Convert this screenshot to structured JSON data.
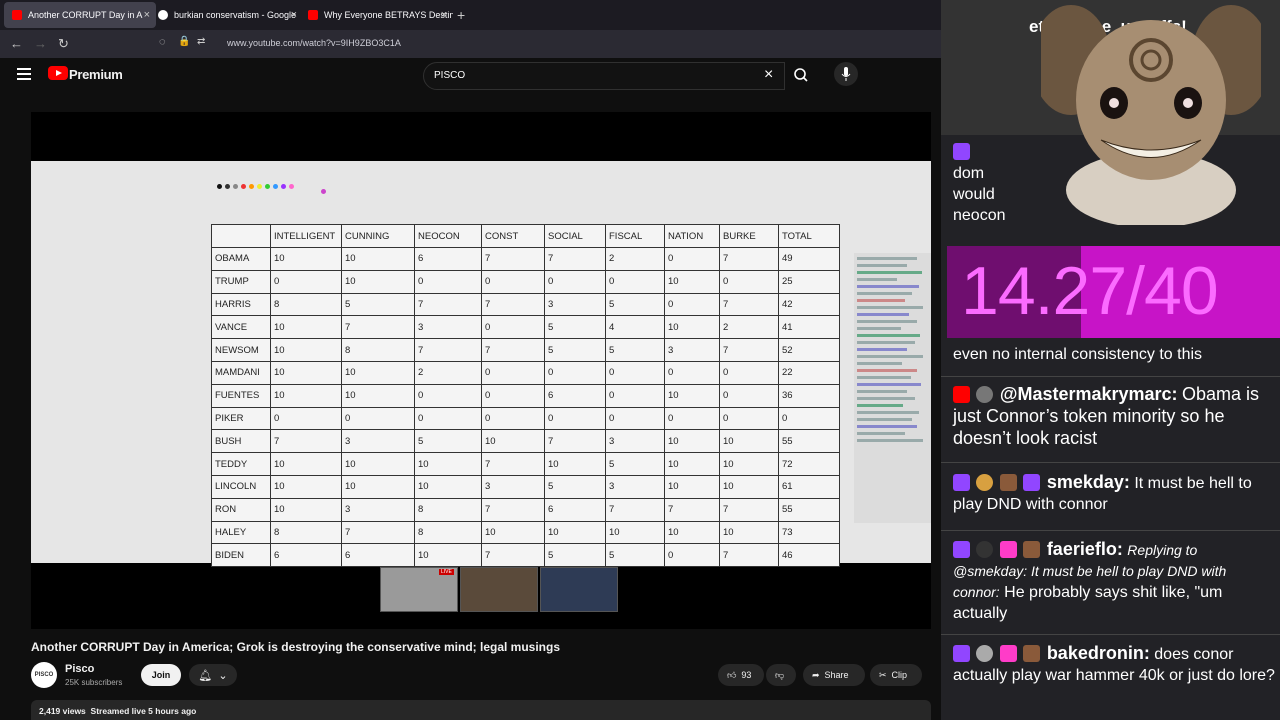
{
  "browser": {
    "tabs": [
      {
        "title": "Another CORRUPT Day in A",
        "active": true
      },
      {
        "title": "burkian conservatism - Google",
        "active": false
      },
      {
        "title": "Why Everyone BETRAYS Destiny",
        "active": false
      }
    ],
    "url": "www.youtube.com/watch?v=9IH9ZBO3C1A"
  },
  "youtube": {
    "logo_text": "Premium",
    "search_value": "PISCO",
    "video_title": "Another CORRUPT Day in America; Grok is destroying the conservative mind; legal musings",
    "channel": {
      "name": "Pisco",
      "subscribers": "25K subscribers",
      "avatar_text": "PISCO"
    },
    "join_label": "Join",
    "likes": "93",
    "share_label": "Share",
    "clip_label": "Clip",
    "views": "2,419 views",
    "streamed": "Streamed live 5 hours ago",
    "live_badge": "LIVE"
  },
  "table": {
    "headers": [
      "",
      "INTELLIGENT",
      "CUNNING",
      "NEOCON",
      "CONST",
      "SOCIAL",
      "FISCAL",
      "NATION",
      "BURKE",
      "TOTAL"
    ],
    "rows": [
      [
        "OBAMA",
        "10",
        "10",
        "6",
        "7",
        "7",
        "2",
        "0",
        "7",
        "49"
      ],
      [
        "TRUMP",
        "0",
        "10",
        "0",
        "0",
        "0",
        "0",
        "10",
        "0",
        "25"
      ],
      [
        "HARRIS",
        "8",
        "5",
        "7",
        "7",
        "3",
        "5",
        "0",
        "7",
        "42"
      ],
      [
        "VANCE",
        "10",
        "7",
        "3",
        "0",
        "5",
        "4",
        "10",
        "2",
        "41"
      ],
      [
        "NEWSOM",
        "10",
        "8",
        "7",
        "7",
        "5",
        "5",
        "3",
        "7",
        "52"
      ],
      [
        "MAMDANI",
        "10",
        "10",
        "2",
        "0",
        "0",
        "0",
        "0",
        "0",
        "22"
      ],
      [
        "FUENTES",
        "10",
        "10",
        "0",
        "0",
        "6",
        "0",
        "10",
        "0",
        "36"
      ],
      [
        "PIKER",
        "0",
        "0",
        "0",
        "0",
        "0",
        "0",
        "0",
        "0",
        "0"
      ],
      [
        "BUSH",
        "7",
        "3",
        "5",
        "10",
        "7",
        "3",
        "10",
        "10",
        "55"
      ],
      [
        "TEDDY",
        "10",
        "10",
        "10",
        "7",
        "10",
        "5",
        "10",
        "10",
        "72"
      ],
      [
        "LINCOLN",
        "10",
        "10",
        "10",
        "3",
        "5",
        "3",
        "10",
        "10",
        "61"
      ],
      [
        "RON",
        "10",
        "3",
        "8",
        "7",
        "6",
        "7",
        "7",
        "7",
        "55"
      ],
      [
        "HALEY",
        "8",
        "7",
        "8",
        "10",
        "10",
        "10",
        "10",
        "10",
        "73"
      ],
      [
        "BIDEN",
        "6",
        "6",
        "10",
        "7",
        "5",
        "5",
        "0",
        "7",
        "46"
      ]
    ]
  },
  "chat": {
    "top_user": "etal_slime_usa:",
    "top_text": "ffs!",
    "partial_lines": [
      "dom",
      "would",
      "neocon"
    ],
    "score": "14.27/40",
    "line_after_score": "even no internal consistency to this",
    "messages": [
      {
        "user": "@Mastermakrymarc:",
        "text": "Obama is just Connor’s token minority so he doesn’t look racist"
      },
      {
        "user": "smekday:",
        "text": "It must be hell to play DND with connor"
      },
      {
        "user": "faerieflo:",
        "reply": "Replying to @smekday: It must be hell to play DND with connor:",
        "text": "He probably says shit like, \"um actually"
      },
      {
        "user": "bakedronin:",
        "text": "does conor actually play war hammer 40k or just do lore?"
      }
    ]
  },
  "colors": {
    "accent": "#ff0000",
    "twitch": "#9146ff",
    "score_bg": "#c714c7"
  }
}
